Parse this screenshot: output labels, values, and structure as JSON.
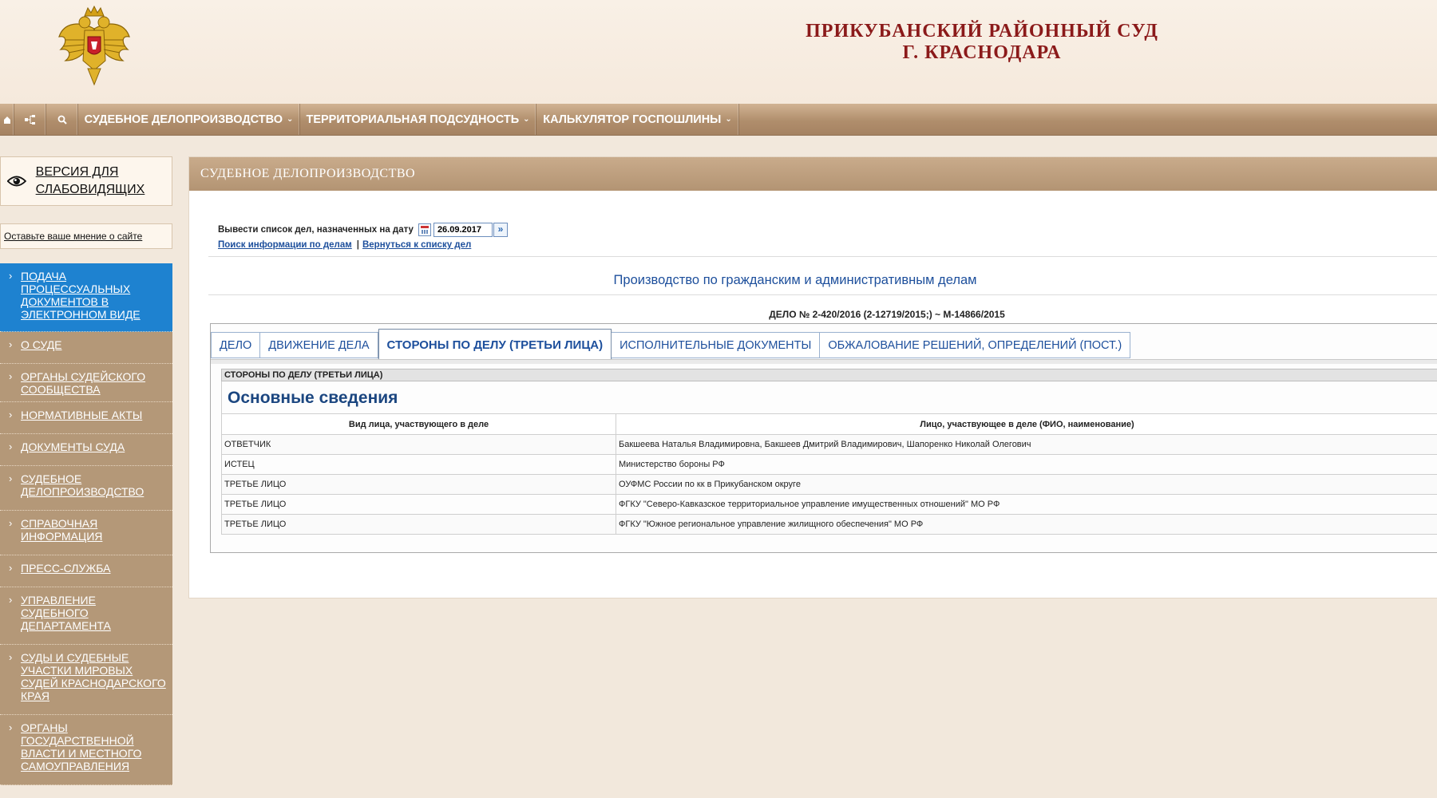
{
  "header": {
    "court_line1": "ПРИКУБАНСКИЙ РАЙОННЫЙ СУД",
    "court_line2": "Г. КРАСНОДАРА"
  },
  "nav": {
    "icons": [
      "home-icon",
      "sitemap-icon",
      "search-icon"
    ],
    "items": [
      {
        "label": "СУДЕБНОЕ ДЕЛОПРОИЗВОДСТВО"
      },
      {
        "label": "ТЕРРИТОРИАЛЬНАЯ ПОДСУДНОСТЬ"
      },
      {
        "label": "КАЛЬКУЛЯТОР ГОСПОШЛИНЫ"
      }
    ]
  },
  "sidebar": {
    "low_vision_label": "ВЕРСИЯ ДЛЯ СЛАБОВИДЯЩИХ",
    "feedback_label": "Оставьте ваше мнение о сайте",
    "menu": [
      {
        "label": "ПОДАЧА ПРОЦЕССУАЛЬНЫХ ДОКУМЕНТОВ В ЭЛЕКТРОННОМ ВИДЕ"
      },
      {
        "label": "О СУДЕ"
      },
      {
        "label": "ОРГАНЫ СУДЕЙСКОГО СООБЩЕСТВА"
      },
      {
        "label": "НОРМАТИВНЫЕ АКТЫ"
      },
      {
        "label": "ДОКУМЕНТЫ СУДА"
      },
      {
        "label": "СУДЕБНОЕ ДЕЛОПРОИЗВОДСТВО"
      },
      {
        "label": "СПРАВОЧНАЯ ИНФОРМАЦИЯ"
      },
      {
        "label": "ПРЕСС-СЛУЖБА"
      },
      {
        "label": "УПРАВЛЕНИЕ СУДЕБНОГО ДЕПАРТАМЕНТА"
      },
      {
        "label": "СУДЫ И СУДЕБНЫЕ УЧАСТКИ МИРОВЫХ СУДЕЙ КРАСНОДАРСКОГО КРАЯ"
      },
      {
        "label": "ОРГАНЫ ГОСУДАРСТВЕННОЙ ВЛАСТИ И МЕСТНОГО САМОУПРАВЛЕНИЯ"
      }
    ]
  },
  "content": {
    "heading": "СУДЕБНОЕ ДЕЛОПРОИЗВОДСТВО",
    "date_prompt": "Вывести список дел, назначенных на дату",
    "date_value": "26.09.2017",
    "link_search": "Поиск информации по делам",
    "link_separator": "|",
    "link_back": "Вернуться к списку дел",
    "proceeding_title": "Производство по гражданским и административным делам",
    "case_number": "ДЕЛО № 2-420/2016 (2-12719/2015;) ~ М-14866/2015",
    "tabs": [
      {
        "label": "ДЕЛО"
      },
      {
        "label": "ДВИЖЕНИЕ ДЕЛА"
      },
      {
        "label": "СТОРОНЫ ПО ДЕЛУ (ТРЕТЬИ ЛИЦА)"
      },
      {
        "label": "ИСПОЛНИТЕЛЬНЫЕ ДОКУМЕНТЫ"
      },
      {
        "label": "ОБЖАЛОВАНИЕ РЕШЕНИЙ, ОПРЕДЕЛЕНИЙ (ПОСТ.)"
      }
    ],
    "section_label": "СТОРОНЫ ПО ДЕЛУ (ТРЕТЬИ ЛИЦА)",
    "main_info": "Основные сведения",
    "table": {
      "headers": [
        "Вид лица, участвующего в деле",
        "Лицо, участвующее в деле (ФИО, наименование)"
      ],
      "rows": [
        [
          "ОТВЕТЧИК",
          "Бакшеева Наталья Владимировна, Бакшеев Дмитрий Владимирович, Шапоренко Николай Олегович"
        ],
        [
          "ИСТЕЦ",
          "Министерство бороны РФ"
        ],
        [
          "ТРЕТЬЕ ЛИЦО",
          "ОУФМС России по кк в Прикубанском округе"
        ],
        [
          "ТРЕТЬЕ ЛИЦО",
          "ФГКУ \"Северо-Кавказское территориальное управление имущественных отношений\" МО РФ"
        ],
        [
          "ТРЕТЬЕ ЛИЦО",
          "ФГКУ \"Южное региональное управление жилищного обеспечения\" МО РФ"
        ]
      ]
    }
  },
  "colors": {
    "title_red": "#8b1a1a",
    "nav_brown": "#b08e6c",
    "menu_brown": "#b49878",
    "menu_active_blue": "#1e82d0",
    "link_blue": "#1d4f9c"
  }
}
